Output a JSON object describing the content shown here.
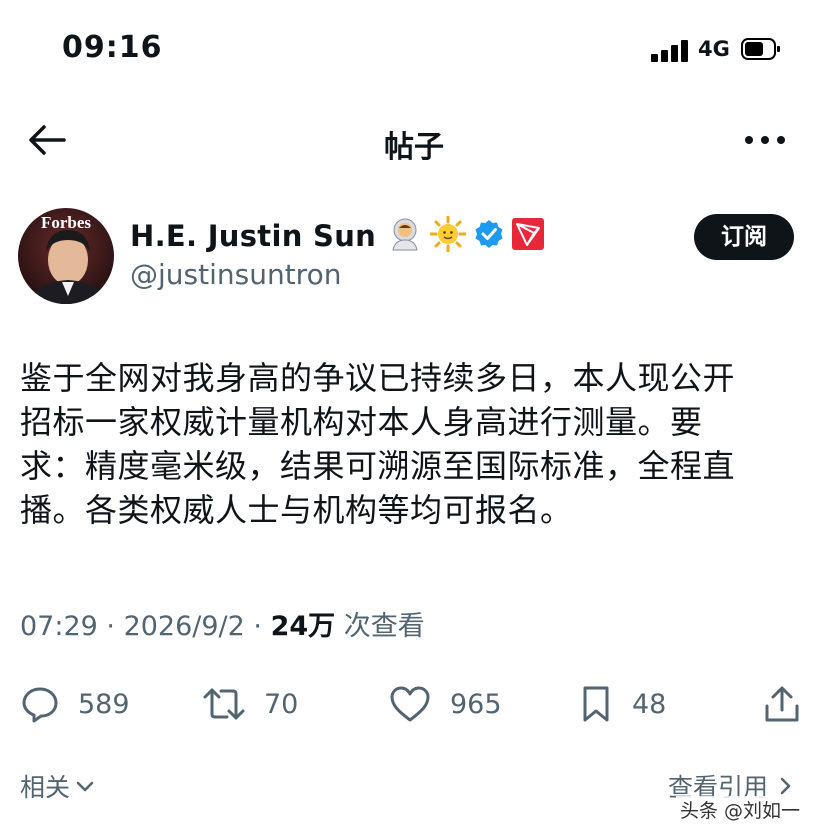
{
  "status_bar": {
    "time": "09:16",
    "network": "4G"
  },
  "nav": {
    "title": "帖子"
  },
  "author": {
    "avatar_text": "Forbes",
    "name": "H.E. Justin Sun",
    "handle": "@justinsuntron",
    "badges": [
      "astronaut-emoji",
      "sun-emoji",
      "verified-badge",
      "tron-logo"
    ]
  },
  "subscribe_label": "订阅",
  "post": {
    "lines": [
      "鉴于全网对我身高的争议已持续多日，本人现公开",
      "招标一家权威计量机构对本人身高进行测量。要",
      "求：精度毫米级，结果可溯源至国际标准，全程直",
      "播。各类权威人士与机构等均可报名。"
    ]
  },
  "meta": {
    "time": "07:29",
    "date": "2026/9/2",
    "views": "24万",
    "views_label": "次查看"
  },
  "actions": {
    "replies": "589",
    "reposts": "70",
    "likes": "965",
    "bookmarks": "48"
  },
  "bottom": {
    "related": "相关",
    "quotes": "查看引用"
  },
  "watermark": "头条 @刘如一"
}
